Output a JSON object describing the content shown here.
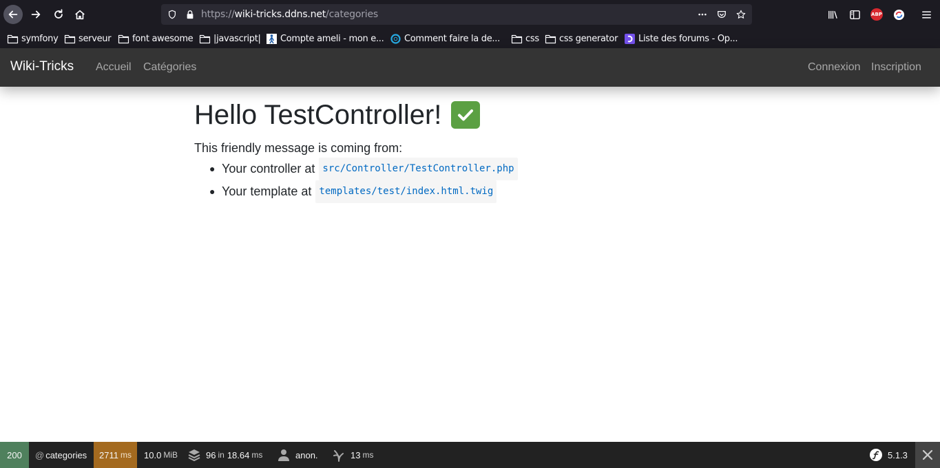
{
  "browser": {
    "url_scheme": "https://",
    "url_host": "wiki-tricks.ddns.net",
    "url_path": "/categories",
    "bookmarks": [
      {
        "label": "symfony",
        "icon": "folder-icon"
      },
      {
        "label": "serveur",
        "icon": "folder-icon"
      },
      {
        "label": "font awesome",
        "icon": "folder-icon"
      },
      {
        "label": "|javascript|",
        "icon": "folder-icon"
      },
      {
        "label": "Compte ameli - mon e...",
        "icon": "ameli-favicon-icon"
      },
      {
        "label": "Comment faire la de...",
        "icon": "site-favicon-icon"
      },
      {
        "label": "css",
        "icon": "folder-icon"
      },
      {
        "label": "css generator",
        "icon": "folder-icon"
      },
      {
        "label": "Liste des forums - Op...",
        "icon": "openclassrooms-favicon-icon"
      }
    ],
    "extensions": {
      "abp": "ABP"
    }
  },
  "site": {
    "brand": "Wiki-Tricks",
    "nav_left": [
      "Accueil",
      "Catégories"
    ],
    "nav_right": [
      "Connexion",
      "Inscription"
    ]
  },
  "main": {
    "heading": "Hello TestController!",
    "heading_emoji": "check-mark-button-icon",
    "intro": "This friendly message is coming from:",
    "items": [
      {
        "text": "Your controller at",
        "code": "src/Controller/TestController.php"
      },
      {
        "text": "Your template at",
        "code": "templates/test/index.html.twig"
      }
    ]
  },
  "toolbar": {
    "status": "200",
    "route_at": "@",
    "route": "categories",
    "time_value": "2711",
    "time_unit": "ms",
    "memory_value": "10.0",
    "memory_unit": "MiB",
    "templates_count": "96",
    "templates_in": "in",
    "templates_time": "18.64",
    "templates_unit": "ms",
    "user": "anon.",
    "twig_time": "13",
    "twig_unit": "ms",
    "symfony_version": "5.1.3"
  },
  "colors": {
    "status_ok": "#4f805d",
    "time_warning": "#a46a1f",
    "code_text": "#0069c2"
  }
}
